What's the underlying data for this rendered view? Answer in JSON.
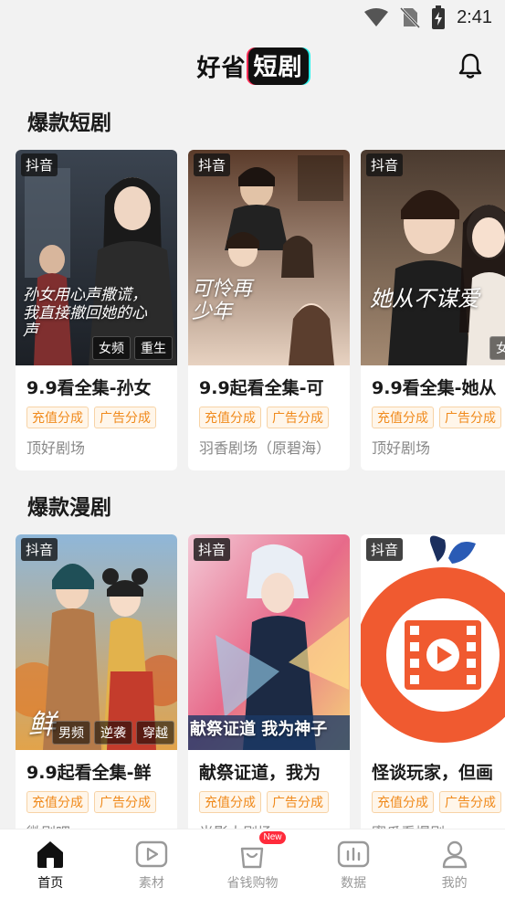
{
  "status_bar": {
    "time": "2:41"
  },
  "app": {
    "logo_main": "好省",
    "logo_badge": "短剧"
  },
  "sections": [
    {
      "title": "爆款短剧",
      "cards": [
        {
          "platform": "抖音",
          "title": "9.9看全集-孙女",
          "tags": [
            "女频",
            "重生"
          ],
          "script": "孙女用心声撒谎，我直接撤回她的心声",
          "share_tags": [
            "充值分成",
            "广告分成"
          ],
          "theater": "顶好剧场"
        },
        {
          "platform": "抖音",
          "title": "9.9起看全集-可",
          "tags": [],
          "script": "可怜再少年",
          "share_tags": [
            "充值分成",
            "广告分成"
          ],
          "theater": "羽香剧场（原碧海）"
        },
        {
          "platform": "抖音",
          "title": "9.9看全集-她从",
          "tags": [
            "女频"
          ],
          "script": "她从不谋爱",
          "share_tags": [
            "充值分成",
            "广告分成"
          ],
          "theater": "顶好剧场"
        }
      ]
    },
    {
      "title": "爆款漫剧",
      "cards": [
        {
          "platform": "抖音",
          "title": "9.9起看全集-鲜",
          "tags": [
            "男频",
            "逆袭",
            "穿越"
          ],
          "script": "鲜",
          "share_tags": [
            "充值分成",
            "广告分成"
          ],
          "theater": "微剧吧"
        },
        {
          "platform": "抖音",
          "title": "献祭证道，我为",
          "tags": [],
          "script": "献祭证道 我为神子",
          "share_tags": [
            "充值分成",
            "广告分成"
          ],
          "theater": "光影大剧场"
        },
        {
          "platform": "抖音",
          "title": "怪谈玩家，但画",
          "tags": [],
          "script": "",
          "share_tags": [
            "充值分成",
            "广告分成"
          ],
          "theater": "蜜瓜看爆剧"
        }
      ]
    }
  ],
  "nav": [
    {
      "label": "首页",
      "icon": "home-icon",
      "active": true
    },
    {
      "label": "素材",
      "icon": "play-video-icon"
    },
    {
      "label": "省钱购物",
      "icon": "shopping-bag-icon",
      "badge": "New"
    },
    {
      "label": "数据",
      "icon": "bar-chart-icon"
    },
    {
      "label": "我的",
      "icon": "user-icon"
    }
  ]
}
